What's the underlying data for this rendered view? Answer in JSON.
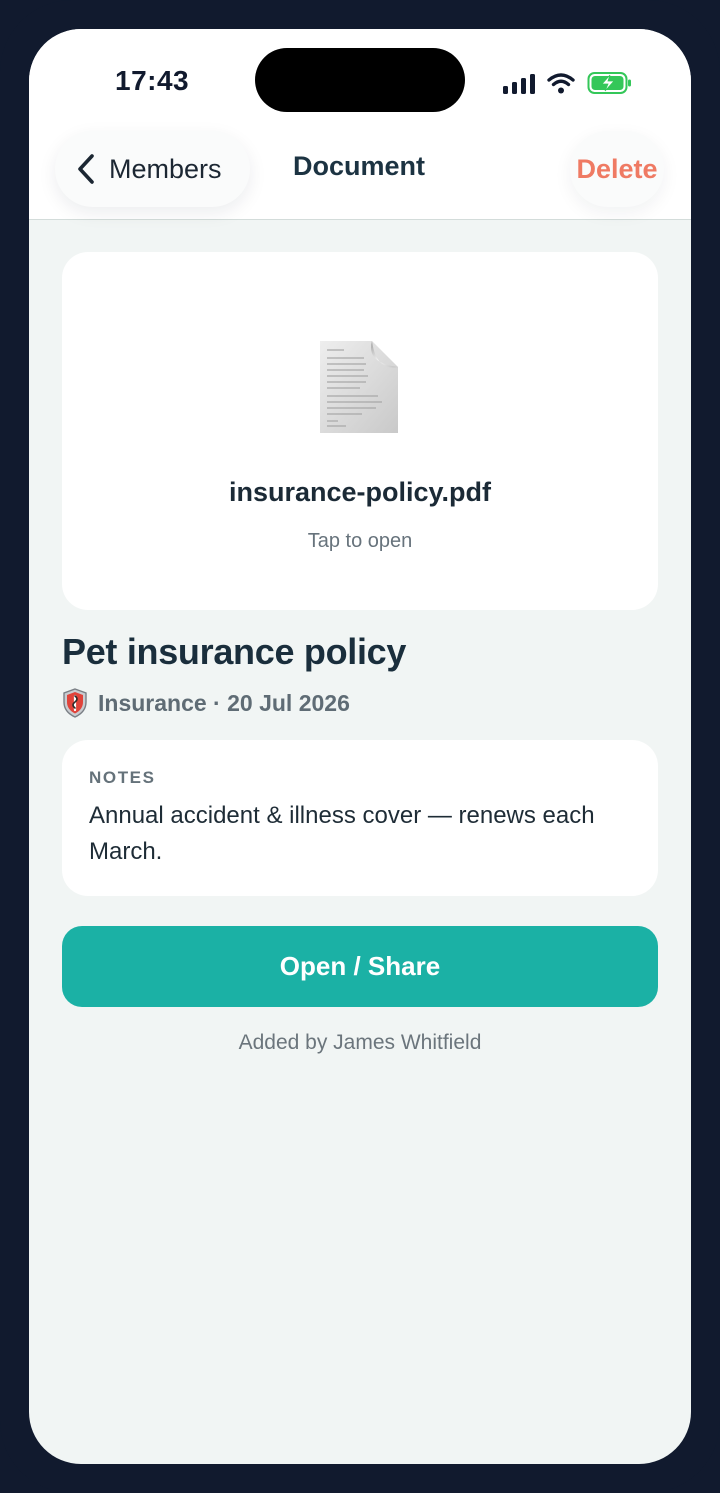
{
  "status_bar": {
    "time": "17:43",
    "icons": [
      "signal-icon",
      "wifi-icon",
      "battery-charging-icon"
    ]
  },
  "nav": {
    "back_label": "Members",
    "title": "Document",
    "delete_label": "Delete"
  },
  "file": {
    "name": "insurance-policy.pdf",
    "hint": "Tap to open"
  },
  "document": {
    "title": "Pet insurance policy",
    "meta": "Insurance · 20 Jul 2026",
    "category_icon": "shield-icon"
  },
  "notes": {
    "label": "NOTES",
    "body": "Annual accident & illness cover — renews each March."
  },
  "actions": {
    "open_share_label": "Open / Share"
  },
  "footer": {
    "added_by": "Added by James Whitfield"
  },
  "colors": {
    "accent": "#1bb1a5",
    "danger": "#ef7a63",
    "frame": "#111a2e",
    "background": "#f1f5f4",
    "battery": "#34c759"
  }
}
